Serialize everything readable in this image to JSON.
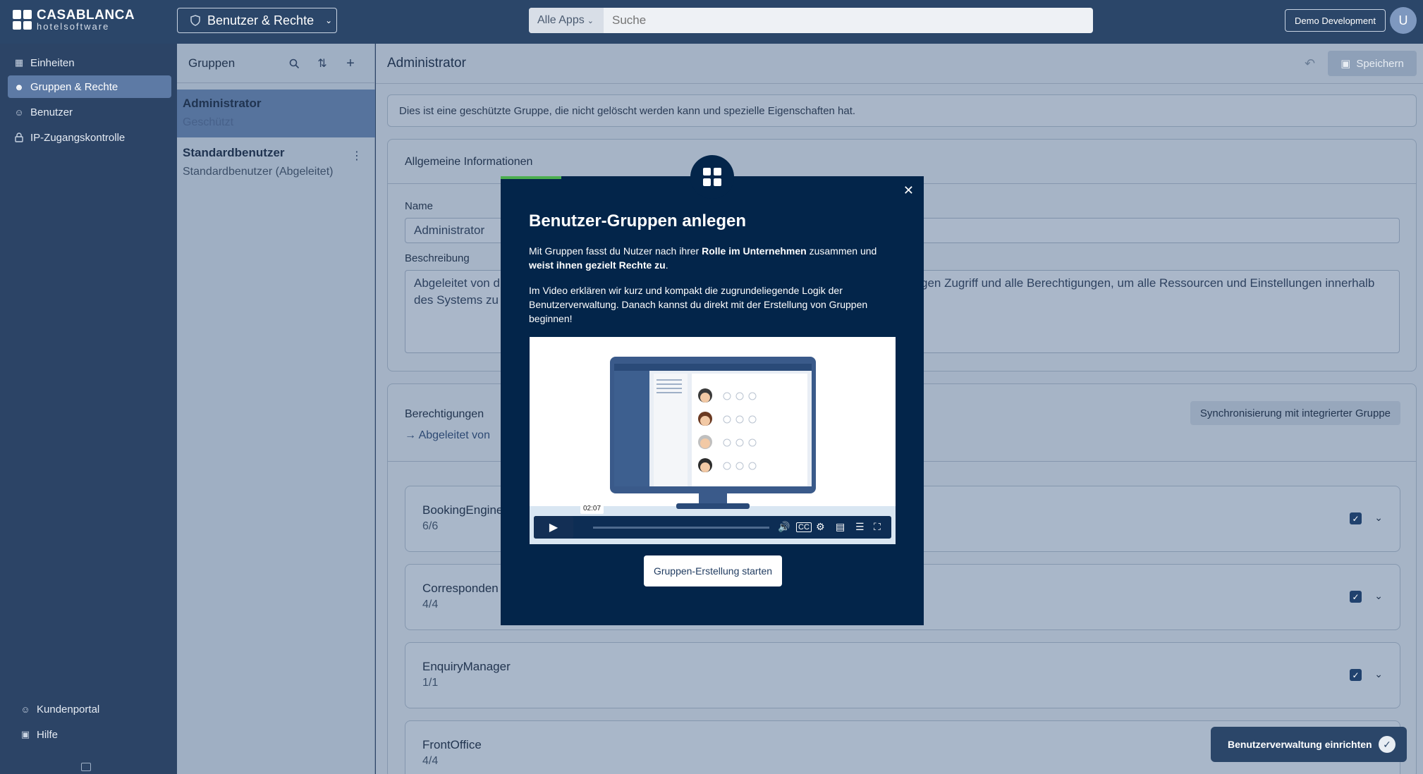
{
  "topbar": {
    "logo_line1": "CASABLANCA",
    "logo_line2": "hotelsoftware",
    "app_switch_label": "Benutzer & Rechte",
    "search_category": "Alle Apps",
    "search_placeholder": "Suche",
    "env_button": "Demo Development",
    "avatar_initial": "U"
  },
  "sidebar": {
    "items": [
      {
        "label": "Einheiten",
        "icon": "building-icon"
      },
      {
        "label": "Gruppen & Rechte",
        "icon": "users-icon",
        "active": true
      },
      {
        "label": "Benutzer",
        "icon": "user-icon"
      },
      {
        "label": "IP-Zugangskontrolle",
        "icon": "lock-icon"
      }
    ],
    "bottom_items": [
      {
        "label": "Kundenportal",
        "icon": "user-icon"
      },
      {
        "label": "Hilfe",
        "icon": "book-icon"
      }
    ]
  },
  "groups": {
    "title": "Gruppen",
    "items": [
      {
        "name": "Administrator",
        "sub": "Geschützt",
        "selected": true
      },
      {
        "name": "Standardbenutzer",
        "sub": "Standardbenutzer (Abgeleitet)"
      }
    ]
  },
  "main": {
    "title": "Administrator",
    "save_label": "Speichern",
    "info_text": "Dies ist eine geschützte Gruppe, die nicht gelöscht werden kann und spezielle Eigenschaften hat.",
    "general": {
      "title": "Allgemeine Informationen",
      "name_label": "Name",
      "name_value": "Administrator",
      "desc_label": "Beschreibung",
      "desc_left_line1": "Abgeleitet von d",
      "desc_left_line2": "des Systems zu",
      "desc_right_line1": "gen Zugriff und alle Berechtigungen, um alle Ressourcen und Einstellungen innerhalb"
    },
    "permissions": {
      "title": "Berechtigungen",
      "derived_label": "Abgeleitet von",
      "sync_button": "Synchronisierung mit integrierter Gruppe",
      "rows": [
        {
          "name": "BookingEngine",
          "count": "6/6"
        },
        {
          "name": "Corresponden",
          "count": "4/4"
        },
        {
          "name": "EnquiryManager",
          "count": "1/1"
        },
        {
          "name": "FrontOffice",
          "count": "4/4"
        }
      ]
    }
  },
  "toast": {
    "label": "Benutzerverwaltung einrichten"
  },
  "modal": {
    "title": "Benutzer-Gruppen anlegen",
    "p1_a": "Mit Gruppen fasst du Nutzer nach ihrer ",
    "p1_b": "Rolle im Unternehmen",
    "p1_c": " zusammen und ",
    "p1_d": "weist ihnen gezielt Rechte zu",
    "p1_e": ".",
    "p2": "Im Video erklären wir kurz und kompakt die zugrundeliegende Logik der Benutzerverwaltung. Danach kannst du direkt mit der Erstellung von Gruppen beginnen!",
    "video_time": "02:07",
    "video_progress_fraction": 0,
    "start_button": "Gruppen-Erstellung starten"
  },
  "colors": {
    "brand_dark": "#03254a",
    "accent_green": "#4caf50",
    "topbar": "#2b4669"
  }
}
